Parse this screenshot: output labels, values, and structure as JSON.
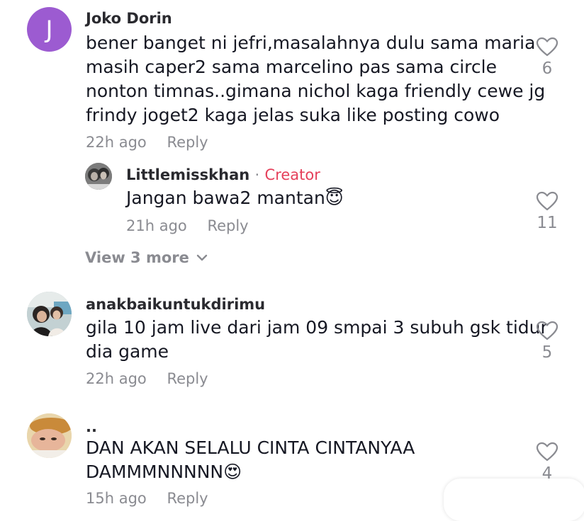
{
  "comments": [
    {
      "username": "Joko Dorin",
      "avatar_letter": "J",
      "avatar_color": "#9c5bd1",
      "lines": [
        "bener banget ni jefri,masalahnya dulu sama maria",
        "masih caper2 sama marcelino pas sama circle",
        "nonton timnas..gimana nichol kaga friendly cewe jg",
        "frindy joget2 kaga jelas suka like posting cowo"
      ],
      "time": "22h ago",
      "reply_label": "Reply",
      "likes": "6"
    },
    {
      "username": "anakbaikuntukdirimu",
      "lines": [
        "gila 10 jam live dari jam 09 smpai 3 subuh gsk tidur",
        "dia game"
      ],
      "time": "22h ago",
      "reply_label": "Reply",
      "likes": "5"
    },
    {
      "username": "..",
      "lines": [
        "DAN AKAN SELALU CINTA CINTANYAA",
        "DAMMMNNNNN😍"
      ],
      "time": "15h ago",
      "reply_label": "Reply",
      "likes": "4"
    }
  ],
  "reply": {
    "username": "Littlemisskhan",
    "separator": "·",
    "creator_label": "Creator",
    "text": "Jangan bawa2 mantan😇",
    "time": "21h ago",
    "reply_label": "Reply",
    "likes": "11"
  },
  "view_more_label": "View 3 more",
  "icons": {
    "like": "heart-outline-icon",
    "view_more": "chevron-down-icon"
  },
  "colors": {
    "creator": "#e5405b",
    "muted": "#8a8b91",
    "text": "#161823"
  }
}
